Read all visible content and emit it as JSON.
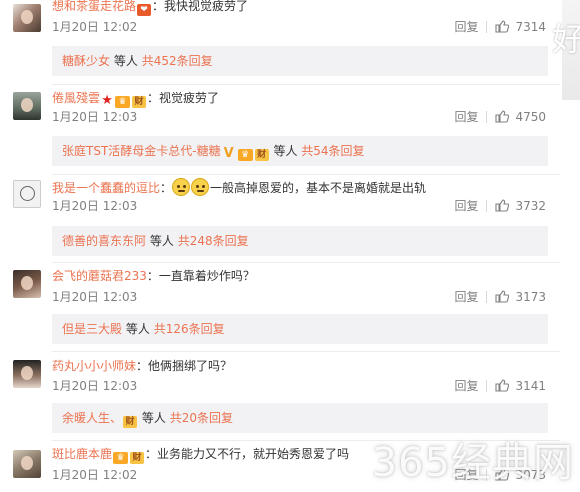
{
  "comments": [
    {
      "user": "想和茶蛋走花路",
      "text": "：我快视觉疲劳了",
      "time": "1月20日 12:02",
      "reply_label": "回复",
      "likes": "7314",
      "replies": {
        "who": "糖酥少女",
        "etc": "等人",
        "count": "共452条回复"
      }
    },
    {
      "user": "倦風殘雲",
      "text": "：视觉疲劳了",
      "time": "1月20日 12:03",
      "reply_label": "回复",
      "likes": "4750",
      "replies": {
        "who": "张庭TST活酵母金卡总代-糖糖",
        "etc": "等人",
        "count": "共54条回复"
      }
    },
    {
      "user": "我是一个蠢蠢的逗比",
      "text": "一般高掉恩爱的，基本不是离婚就是出轨",
      "time": "1月20日 12:03",
      "reply_label": "回复",
      "likes": "3732",
      "replies": {
        "who": "德善的喜东东阿",
        "etc": "等人",
        "count": "共248条回复"
      }
    },
    {
      "user": "会飞的蘑菇君233",
      "text": "：一直靠着炒作吗？",
      "time": "1月20日 12:03",
      "reply_label": "回复",
      "likes": "3173",
      "replies": {
        "who": "但是三大殿",
        "etc": "等人",
        "count": "共126条回复"
      }
    },
    {
      "user": "药丸小小小师妹",
      "text": "：他俩捆绑了吗？",
      "time": "1月20日 12:03",
      "reply_label": "回复",
      "likes": "3141",
      "replies": {
        "who": "余暖人生、",
        "etc": "等人",
        "count": "共20条回复"
      }
    },
    {
      "user": "斑比鹿本鹿",
      "text": "：业务能力又不行，就开始秀恩爱了吗",
      "time": "1月20日 12:02",
      "reply_label": "回复",
      "likes": "3073"
    }
  ],
  "watermark": "365经典网",
  "edge_glyph": "好"
}
